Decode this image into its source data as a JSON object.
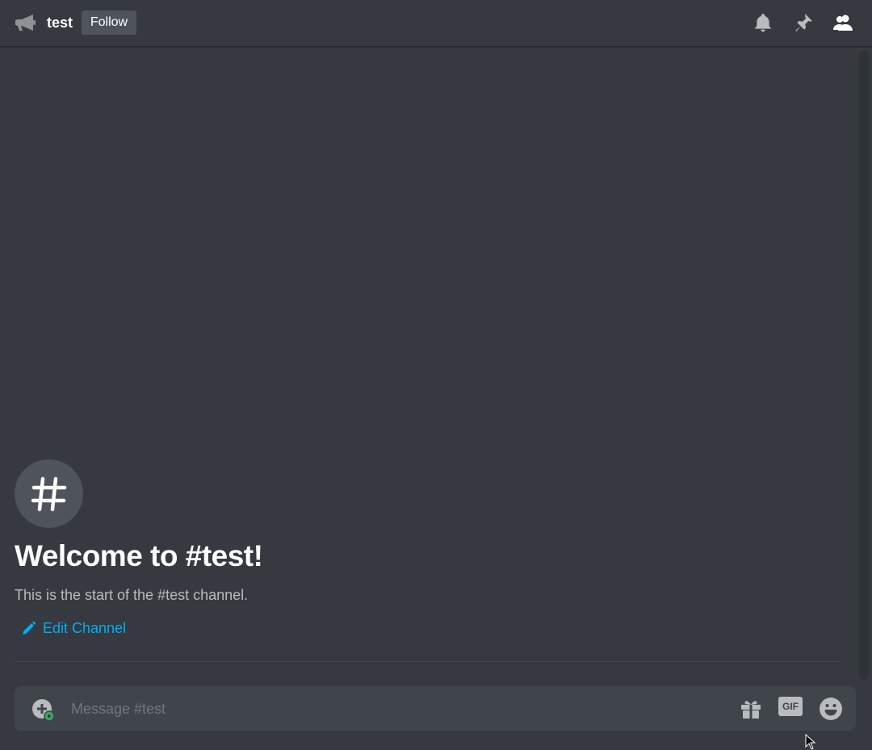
{
  "header": {
    "channel_name": "test",
    "follow_label": "Follow",
    "icons": [
      "announcement-channel-icon",
      "bell-icon",
      "pin-icon",
      "members-icon"
    ]
  },
  "welcome": {
    "avatar_glyph": "#",
    "title": "Welcome to #test!",
    "subtitle": "This is the start of the #test channel.",
    "edit_label": "Edit Channel"
  },
  "composer": {
    "placeholder": "Message #test",
    "value": "",
    "gif_label": "GIF",
    "icons": [
      "attach-plus-icon",
      "gift-icon",
      "gif-icon",
      "emoji-icon"
    ]
  },
  "colors": {
    "background": "#36393f",
    "header_text": "#ffffff",
    "link": "#00aff4",
    "button_bg": "#4f545c",
    "composer_bg": "#40444b",
    "muted_text": "#b9bbbe",
    "status_green": "#3ba55c"
  }
}
